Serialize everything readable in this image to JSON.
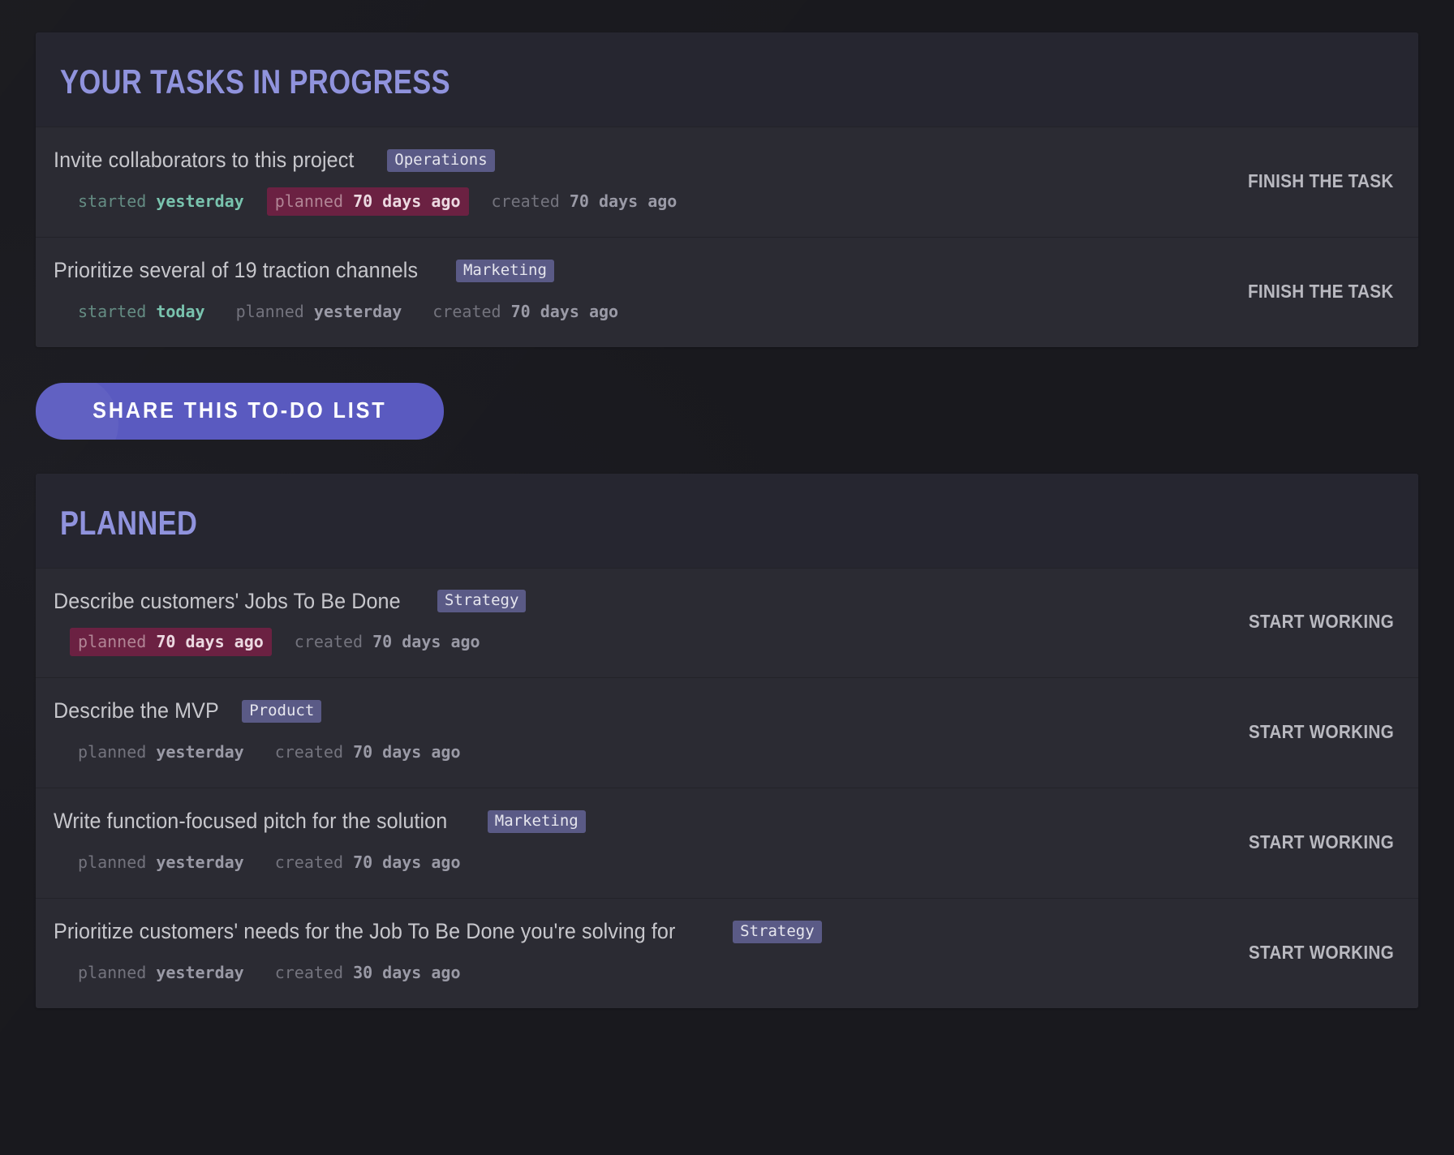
{
  "theme": {
    "page_bg": "#19191e",
    "card_bg": "#2b2b33",
    "header_bg": "#262630",
    "heading_color": "#9093dd",
    "tag_bg": "#5a5a86",
    "overdue_bg": "#6b2142",
    "started_color": "#79c3ae",
    "share_button_bg": "#5a5ac0",
    "action_color": "#b9b9c0"
  },
  "sections": [
    {
      "id": "in-progress",
      "title": "YOUR TASKS IN PROGRESS",
      "tasks": [
        {
          "title": "Invite collaborators to this project",
          "tag": "Operations",
          "action_label": "FINISH THE TASK",
          "meta": [
            {
              "style": "started",
              "key": "started",
              "value": "yesterday"
            },
            {
              "style": "overdue",
              "key": "planned",
              "value": "70 days ago"
            },
            {
              "style": "plain",
              "key": "created",
              "value": "70 days ago"
            }
          ]
        },
        {
          "title": "Prioritize several of 19 traction channels",
          "tag": "Marketing",
          "action_label": "FINISH THE TASK",
          "meta": [
            {
              "style": "started",
              "key": "started",
              "value": "today"
            },
            {
              "style": "plain",
              "key": "planned",
              "value": "yesterday"
            },
            {
              "style": "plain",
              "key": "created",
              "value": "70 days ago"
            }
          ]
        }
      ]
    },
    {
      "id": "planned",
      "title": "PLANNED",
      "tasks": [
        {
          "title": "Describe customers' Jobs To Be Done",
          "tag": "Strategy",
          "action_label": "START WORKING",
          "meta": [
            {
              "style": "overdue",
              "key": "planned",
              "value": "70 days ago"
            },
            {
              "style": "plain",
              "key": "created",
              "value": "70 days ago"
            }
          ]
        },
        {
          "title": "Describe the MVP",
          "tag": "Product",
          "action_label": "START WORKING",
          "meta": [
            {
              "style": "plain",
              "key": "planned",
              "value": "yesterday"
            },
            {
              "style": "plain",
              "key": "created",
              "value": "70 days ago"
            }
          ]
        },
        {
          "title": "Write function-focused pitch for the solution",
          "tag": "Marketing",
          "action_label": "START WORKING",
          "meta": [
            {
              "style": "plain",
              "key": "planned",
              "value": "yesterday"
            },
            {
              "style": "plain",
              "key": "created",
              "value": "70 days ago"
            }
          ]
        },
        {
          "title": "Prioritize customers' needs for the Job To Be Done you're solving for",
          "tag": "Strategy",
          "action_label": "START WORKING",
          "meta": [
            {
              "style": "plain",
              "key": "planned",
              "value": "yesterday"
            },
            {
              "style": "plain",
              "key": "created",
              "value": "30 days ago"
            }
          ]
        }
      ]
    }
  ],
  "share_button": {
    "label": "SHARE THIS TO-DO LIST"
  }
}
